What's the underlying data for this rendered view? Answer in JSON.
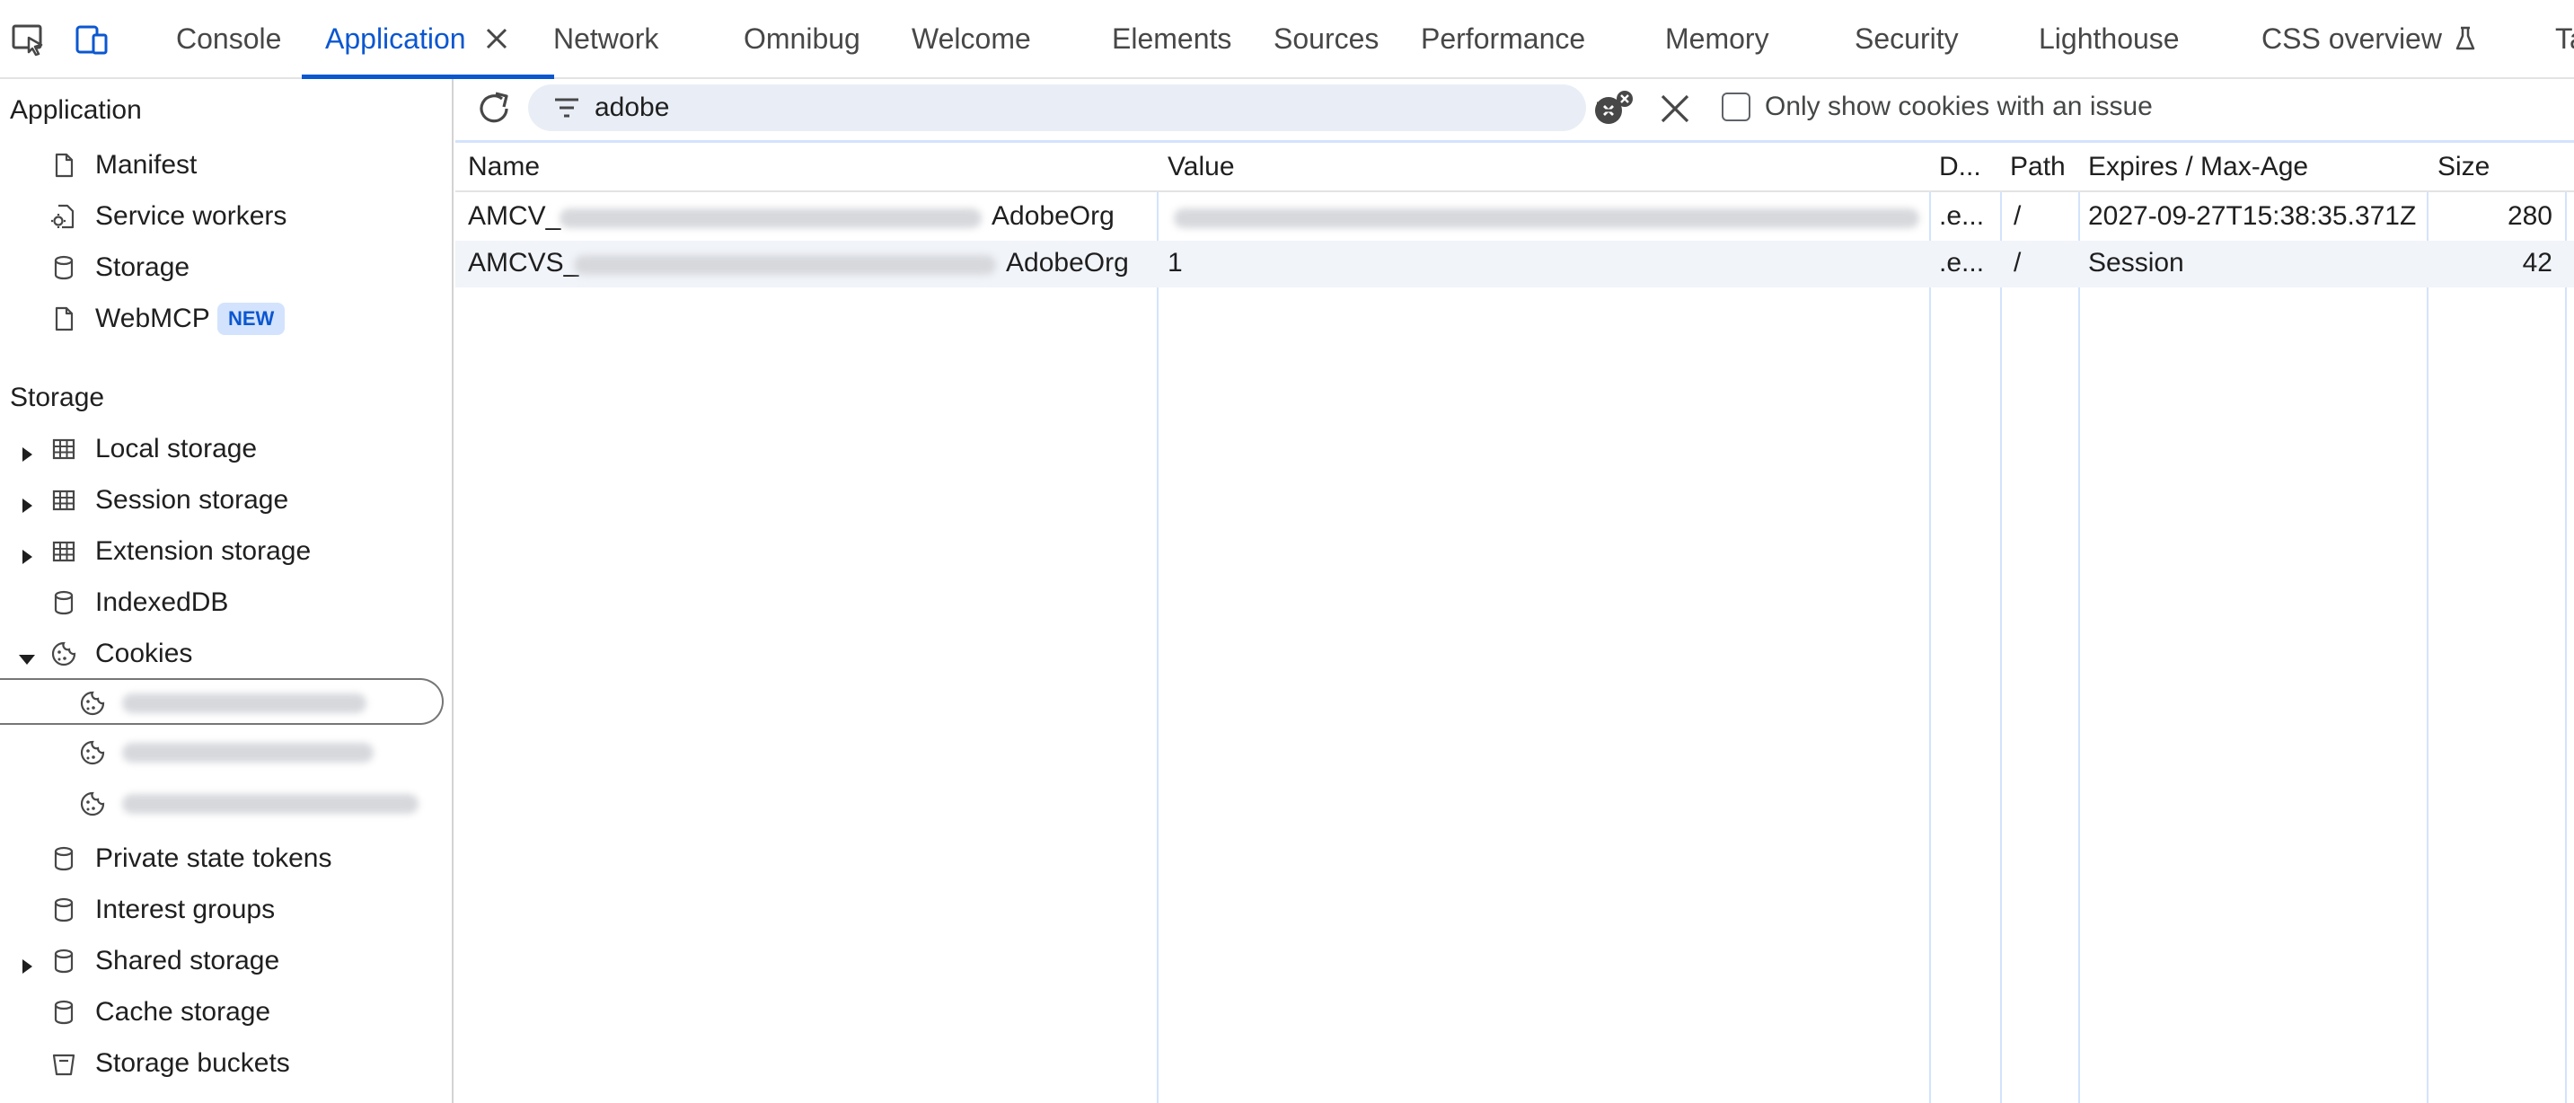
{
  "tabbar": {
    "tabs": [
      {
        "label": "Console"
      },
      {
        "label": "Application"
      },
      {
        "label": "Network"
      },
      {
        "label": "Omnibug"
      },
      {
        "label": "Welcome"
      },
      {
        "label": "Elements"
      },
      {
        "label": "Sources"
      },
      {
        "label": "Performance"
      },
      {
        "label": "Memory"
      },
      {
        "label": "Security"
      },
      {
        "label": "Lighthouse"
      },
      {
        "label": "CSS overview"
      },
      {
        "label": "Ta"
      }
    ],
    "active_tab": "Application",
    "icons": [
      "inspect-element-icon",
      "device-toolbar-icon",
      "close-icon",
      "flask-icon"
    ]
  },
  "sidebar": {
    "application_title": "Application",
    "application_items": [
      {
        "label": "Manifest",
        "icon": "file-icon"
      },
      {
        "label": "Service workers",
        "icon": "gear-file-icon"
      },
      {
        "label": "Storage",
        "icon": "database-icon"
      },
      {
        "label": "WebMCP",
        "icon": "file-icon",
        "badge": "NEW"
      }
    ],
    "storage_title": "Storage",
    "storage_items": [
      {
        "label": "Local storage",
        "icon": "table-icon"
      },
      {
        "label": "Session storage",
        "icon": "table-icon"
      },
      {
        "label": "Extension storage",
        "icon": "table-icon"
      },
      {
        "label": "IndexedDB",
        "icon": "database-icon"
      },
      {
        "label": "Cookies",
        "icon": "cookie-icon"
      },
      {
        "label": "Private state tokens",
        "icon": "database-icon"
      },
      {
        "label": "Interest groups",
        "icon": "database-icon"
      },
      {
        "label": "Shared storage",
        "icon": "database-icon"
      },
      {
        "label": "Cache storage",
        "icon": "database-icon"
      },
      {
        "label": "Storage buckets",
        "icon": "bucket-icon"
      }
    ]
  },
  "toolbar": {
    "filter_value": "adobe",
    "checkbox_label": "Only show cookies with an issue",
    "checkbox_checked": false
  },
  "table": {
    "headers": {
      "name": "Name",
      "value": "Value",
      "domain": "D...",
      "path": "Path",
      "expires": "Expires / Max-Age",
      "size": "Size"
    },
    "rows": [
      {
        "name_prefix": "AMCV_",
        "name_suffix": "AdobeOrg",
        "value": "",
        "domain": ".e...",
        "path": "/",
        "expires": "2027-09-27T15:38:35.371Z",
        "size": "280"
      },
      {
        "name_prefix": "AMCVS_",
        "name_suffix": "AdobeOrg",
        "value": "1",
        "domain": ".e...",
        "path": "/",
        "expires": "Session",
        "size": "42"
      }
    ]
  },
  "colors": {
    "accent": "#0b57d0",
    "filter_bg": "#e9eef6",
    "row_alt": "#f1f4f9",
    "column_divider": "#d3e3fd"
  }
}
